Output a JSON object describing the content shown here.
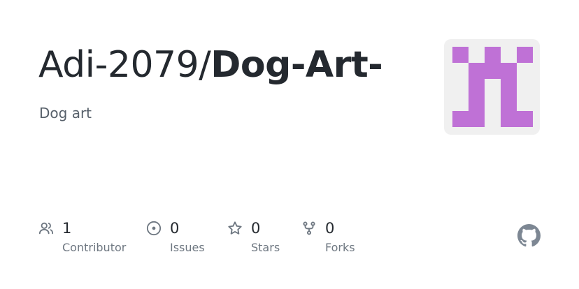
{
  "repo": {
    "owner": "Adi-2079/",
    "name": "Dog-Art-",
    "description": "Dog art"
  },
  "avatar": {
    "color": "#bf71d6",
    "background": "#f0f0f0",
    "icon": "identicon"
  },
  "stats": {
    "contributors": {
      "count": "1",
      "label": "Contributor",
      "icon": "people-icon"
    },
    "issues": {
      "count": "0",
      "label": "Issues",
      "icon": "issue-opened-icon"
    },
    "stars": {
      "count": "0",
      "label": "Stars",
      "icon": "star-icon"
    },
    "forks": {
      "count": "0",
      "label": "Forks",
      "icon": "repo-forked-icon"
    }
  },
  "logo": {
    "icon": "github-mark-icon",
    "color": "#7d8793"
  }
}
